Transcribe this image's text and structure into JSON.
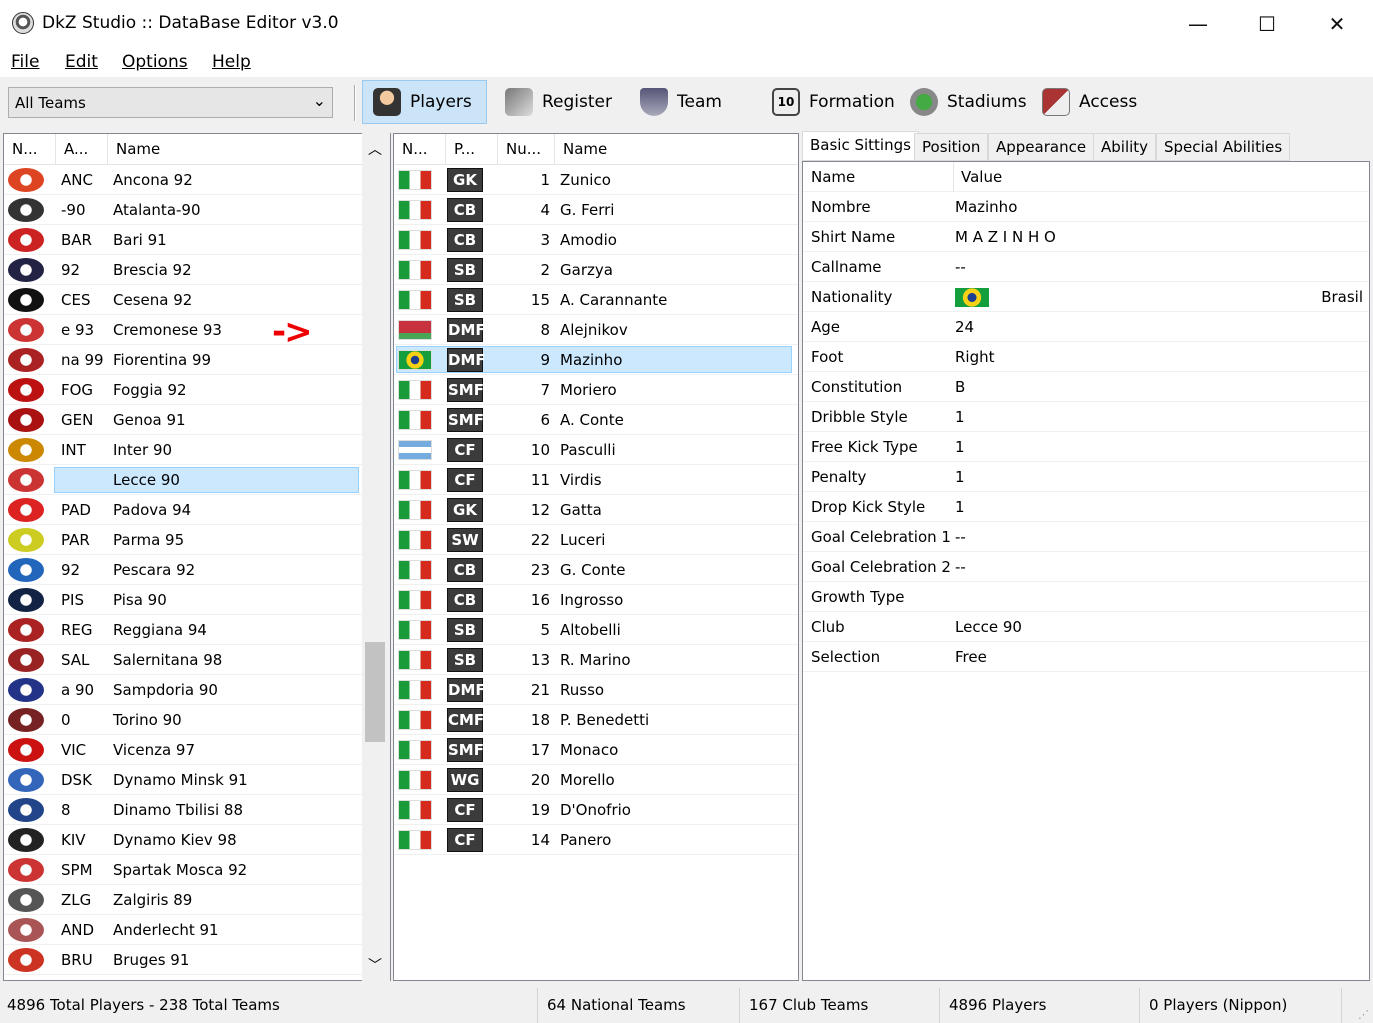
{
  "window": {
    "title": "DkZ Studio :: DataBase Editor v3.0",
    "minimize": "—",
    "maximize": "☐",
    "close": "✕"
  },
  "menu": [
    "File",
    "Edit",
    "Options",
    "Help"
  ],
  "toolbar": {
    "combo_value": "All Teams",
    "buttons": [
      {
        "label": "Players",
        "icon": "player-icon"
      },
      {
        "label": "Register",
        "icon": "register-icon"
      },
      {
        "label": "Team",
        "icon": "team-icon"
      },
      {
        "label": "Formation",
        "icon": "formation-icon"
      },
      {
        "label": "Stadiums",
        "icon": "stadium-icon"
      },
      {
        "label": "Access",
        "icon": "access-icon"
      }
    ]
  },
  "teams_list": {
    "headers": [
      "N...",
      "A...",
      "Name"
    ],
    "selected_index": 10,
    "annotation": "->",
    "rows": [
      {
        "abbr": "ANC",
        "name": "Ancona 92",
        "color": "#d42"
      },
      {
        "abbr": "-90",
        "name": "Atalanta-90",
        "color": "#333"
      },
      {
        "abbr": "BAR",
        "name": "Bari 91",
        "color": "#c22"
      },
      {
        "abbr": "92",
        "name": "Brescia 92",
        "color": "#224"
      },
      {
        "abbr": "CES",
        "name": "Cesena 92",
        "color": "#111"
      },
      {
        "abbr": "e 93",
        "name": "Cremonese 93",
        "color": "#c33"
      },
      {
        "abbr": "na 99",
        "name": "Fiorentina 99",
        "color": "#a22"
      },
      {
        "abbr": "FOG",
        "name": "Foggia 92",
        "color": "#b11"
      },
      {
        "abbr": "GEN",
        "name": "Genoa 91",
        "color": "#a11"
      },
      {
        "abbr": "INT",
        "name": "Inter 90",
        "color": "#c80"
      },
      {
        "abbr": "",
        "name": "Lecce 90",
        "color": "#c33"
      },
      {
        "abbr": "PAD",
        "name": "Padova 94",
        "color": "#d22"
      },
      {
        "abbr": "PAR",
        "name": "Parma 95",
        "color": "#cc2"
      },
      {
        "abbr": "92",
        "name": "Pescara 92",
        "color": "#26b"
      },
      {
        "abbr": "PIS",
        "name": "Pisa 90",
        "color": "#124"
      },
      {
        "abbr": "REG",
        "name": "Reggiana 94",
        "color": "#a22"
      },
      {
        "abbr": "SAL",
        "name": "Salernitana 98",
        "color": "#922"
      },
      {
        "abbr": "a 90",
        "name": "Sampdoria 90",
        "color": "#238"
      },
      {
        "abbr": "0",
        "name": "Torino 90",
        "color": "#722"
      },
      {
        "abbr": "VIC",
        "name": "Vicenza 97",
        "color": "#c11"
      },
      {
        "abbr": "DSK",
        "name": "Dynamo Minsk 91",
        "color": "#36b"
      },
      {
        "abbr": "8",
        "name": "Dinamo Tbilisi 88",
        "color": "#248"
      },
      {
        "abbr": "KIV",
        "name": "Dynamo Kiev 98",
        "color": "#222"
      },
      {
        "abbr": "SPM",
        "name": "Spartak Mosca 92",
        "color": "#c33"
      },
      {
        "abbr": "ZLG",
        "name": "Zalgiris 89",
        "color": "#555"
      },
      {
        "abbr": "AND",
        "name": "Anderlecht 91",
        "color": "#a55"
      },
      {
        "abbr": "BRU",
        "name": "Bruges 91",
        "color": "#c32"
      }
    ]
  },
  "players_list": {
    "headers": [
      "N...",
      "P...",
      "Nu...",
      "Name"
    ],
    "selected_index": 6,
    "rows": [
      {
        "flag": "italy",
        "pos": "GK",
        "num": "1",
        "name": "Zunico"
      },
      {
        "flag": "italy",
        "pos": "CB",
        "num": "4",
        "name": "G. Ferri"
      },
      {
        "flag": "italy",
        "pos": "CB",
        "num": "3",
        "name": "Amodio"
      },
      {
        "flag": "italy",
        "pos": "SB",
        "num": "2",
        "name": "Garzya"
      },
      {
        "flag": "italy",
        "pos": "SB",
        "num": "15",
        "name": "A. Carannante"
      },
      {
        "flag": "belarus",
        "pos": "DMF",
        "num": "8",
        "name": "Alejnikov"
      },
      {
        "flag": "brazil",
        "pos": "DMF",
        "num": "9",
        "name": "Mazinho"
      },
      {
        "flag": "italy",
        "pos": "SMF",
        "num": "7",
        "name": "Moriero"
      },
      {
        "flag": "italy",
        "pos": "SMF",
        "num": "6",
        "name": "A. Conte"
      },
      {
        "flag": "argentina",
        "pos": "CF",
        "num": "10",
        "name": "Pasculli"
      },
      {
        "flag": "italy",
        "pos": "CF",
        "num": "11",
        "name": "Virdis"
      },
      {
        "flag": "italy",
        "pos": "GK",
        "num": "12",
        "name": "Gatta"
      },
      {
        "flag": "italy",
        "pos": "SW",
        "num": "22",
        "name": "Luceri"
      },
      {
        "flag": "italy",
        "pos": "CB",
        "num": "23",
        "name": "G. Conte"
      },
      {
        "flag": "italy",
        "pos": "CB",
        "num": "16",
        "name": "Ingrosso"
      },
      {
        "flag": "italy",
        "pos": "SB",
        "num": "5",
        "name": "Altobelli"
      },
      {
        "flag": "italy",
        "pos": "SB",
        "num": "13",
        "name": "R. Marino"
      },
      {
        "flag": "italy",
        "pos": "DMF",
        "num": "21",
        "name": "Russo"
      },
      {
        "flag": "italy",
        "pos": "CMF",
        "num": "18",
        "name": "P. Benedetti"
      },
      {
        "flag": "italy",
        "pos": "SMF",
        "num": "17",
        "name": "Monaco"
      },
      {
        "flag": "italy",
        "pos": "WG",
        "num": "20",
        "name": "Morello"
      },
      {
        "flag": "italy",
        "pos": "CF",
        "num": "19",
        "name": "D'Onofrio"
      },
      {
        "flag": "italy",
        "pos": "CF",
        "num": "14",
        "name": "Panero"
      }
    ]
  },
  "tabs": [
    "Basic Sittings",
    "Position",
    "Appearance",
    "Ability",
    "Special Abilities"
  ],
  "properties": {
    "headers": [
      "Name",
      "Value"
    ],
    "rows": [
      {
        "key": "Nombre",
        "value": "Mazinho"
      },
      {
        "key": "Shirt Name",
        "value": "M A Z I N H O"
      },
      {
        "key": "Callname",
        "value": "--"
      },
      {
        "key": "Nationality",
        "value": "Brasil",
        "flag": "brazil"
      },
      {
        "key": "Age",
        "value": "24"
      },
      {
        "key": "Foot",
        "value": "Right"
      },
      {
        "key": "Constitution",
        "value": "B"
      },
      {
        "key": "Dribble Style",
        "value": "1"
      },
      {
        "key": "Free Kick Type",
        "value": "1"
      },
      {
        "key": "Penalty",
        "value": "1"
      },
      {
        "key": "Drop Kick Style",
        "value": "1"
      },
      {
        "key": "Goal Celebration 1",
        "value": "--"
      },
      {
        "key": "Goal Celebration 2",
        "value": "--"
      },
      {
        "key": "Growth Type",
        "value": ""
      },
      {
        "key": "Club",
        "value": "Lecce 90"
      },
      {
        "key": "Selection",
        "value": "Free"
      }
    ]
  },
  "status": [
    "4896 Total Players  -  238 Total Teams",
    "64 National Teams",
    "167 Club Teams",
    "4896 Players",
    "0 Players (Nippon)"
  ]
}
